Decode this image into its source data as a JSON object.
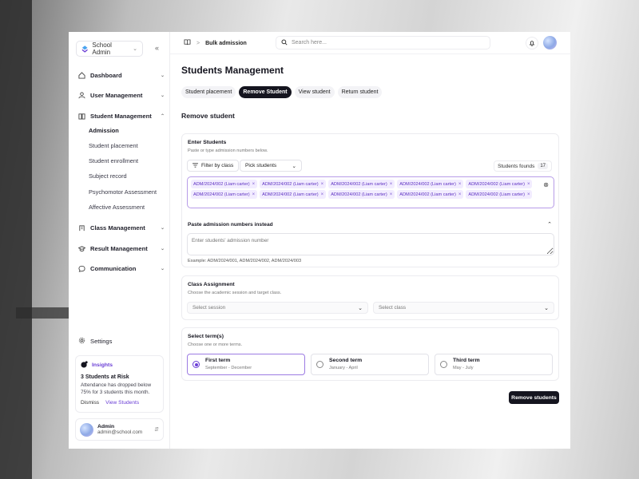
{
  "colors": {
    "accent": "#6b3fd6",
    "dark": "#15151f",
    "chip_bg": "#f2ecff"
  },
  "sidebar": {
    "org_name": "School Admin",
    "nav": [
      {
        "label": "Dashboard",
        "icon": "home-icon"
      },
      {
        "label": "User Management",
        "icon": "user-icon"
      },
      {
        "label": "Student Management",
        "icon": "book-icon"
      },
      {
        "label": "Class Management",
        "icon": "building-icon"
      },
      {
        "label": "Result Management",
        "icon": "graduation-cap-icon"
      },
      {
        "label": "Communication",
        "icon": "chat-icon"
      }
    ],
    "student_sub": [
      "Admission",
      "Student placement",
      "Student enrollment",
      "Subject record",
      "Psychomotor Assessment",
      "Affective Assessment"
    ],
    "settings_label": "Settings",
    "insight": {
      "label": "Insights",
      "title": "3 Students at Risk",
      "desc": "Attendance has dropped below 75% for 3 students this month.",
      "dismiss": "Dismiss",
      "view": "View Students"
    },
    "user": {
      "name": "Admin",
      "email": "admin@school.com"
    }
  },
  "topbar": {
    "breadcrumb": "Bulk admission",
    "search_placeholder": "Search here..."
  },
  "main": {
    "title": "Students Management",
    "tabs": [
      "Student placement",
      "Remove Student",
      "View student",
      "Return student"
    ],
    "active_tab": 1,
    "section_title": "Remove student",
    "enter": {
      "title": "Enter Students",
      "subtitle": "Paste or type admission numbers below.",
      "filter_label": "Filter by class",
      "pick_label": "Pick students",
      "found_label": "Students founds",
      "found_count": "17",
      "chips": [
        "ADM/2024/002 (Liam carter)",
        "ADM/2024/002 (Liam carter)",
        "ADM/2024/002 (Liam carter)",
        "ADM/2024/002 (Liam carter)",
        "ADM/2024/002 (Liam carter)",
        "ADM/2024/002 (Liam carter)",
        "ADM/2024/002 (Liam carter)",
        "ADM/2024/002 (Liam carter)",
        "ADM/2024/002 (Liam carter)",
        "ADM/2024/002 (Liam carter)"
      ],
      "paste_title": "Paste admission numbers instead",
      "paste_placeholder": "Enter students' admission number",
      "example": "Example: ADM/2024/001, ADM/2024/002, ADM/2024/003"
    },
    "class_assignment": {
      "title": "Class Assignment",
      "subtitle": "Choose the academic session and target class.",
      "session_placeholder": "Select session",
      "class_placeholder": "Select class"
    },
    "terms": {
      "title": "Select term(s)",
      "subtitle": "Choose one or more terms.",
      "items": [
        {
          "name": "First term",
          "dates": "September - December",
          "selected": true
        },
        {
          "name": "Second term",
          "dates": "January - April",
          "selected": false
        },
        {
          "name": "Third term",
          "dates": "May - July",
          "selected": false
        }
      ]
    },
    "submit_label": "Remove students"
  }
}
